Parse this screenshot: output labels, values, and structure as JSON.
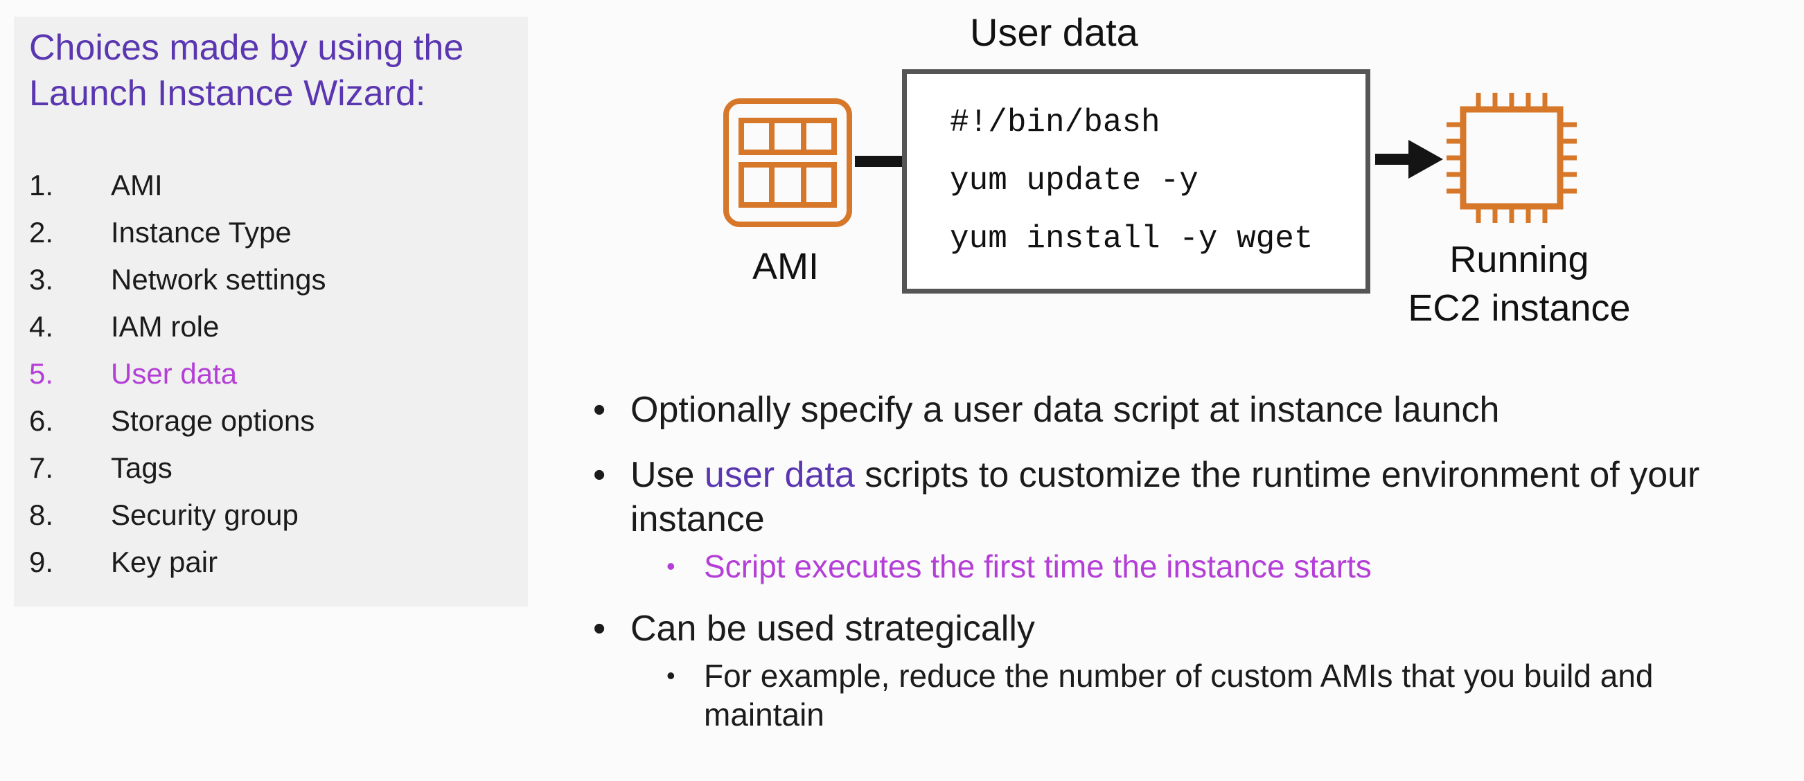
{
  "sidebar": {
    "title": "Choices made by using the Launch Instance Wizard:",
    "items": [
      {
        "num": "1.",
        "label": "AMI"
      },
      {
        "num": "2.",
        "label": "Instance Type"
      },
      {
        "num": "3.",
        "label": "Network settings"
      },
      {
        "num": "4.",
        "label": "IAM role"
      },
      {
        "num": "5.",
        "label": "User data"
      },
      {
        "num": "6.",
        "label": "Storage options"
      },
      {
        "num": "7.",
        "label": "Tags"
      },
      {
        "num": "8.",
        "label": "Security group"
      },
      {
        "num": "9.",
        "label": "Key pair"
      }
    ],
    "active_item": "5."
  },
  "diagram": {
    "title": "User data",
    "ami_label": "AMI",
    "code_lines": [
      "#!/bin/bash",
      "yum update -y",
      "yum install -y wget"
    ],
    "instance_label_line1": "Running",
    "instance_label_line2": "EC2 instance",
    "ami_icon": "ami-icon",
    "instance_icon": "ec2-chip-icon",
    "icon_color": "#d6772a"
  },
  "bullets": {
    "b1": "Optionally specify a user data script at instance launch",
    "b2_pre": "Use ",
    "b2_highlight": "user data",
    "b2_post": " scripts to customize the runtime environment of your instance",
    "b2_sub": "Script executes the first time the instance starts",
    "b3": "Can be used strategically",
    "b3_sub": "For example, reduce the number of custom AMIs that you build and maintain"
  },
  "colors": {
    "accent": "#5a36b0",
    "highlight": "#b43fd6",
    "panel_bg": "#f0f0f0"
  }
}
